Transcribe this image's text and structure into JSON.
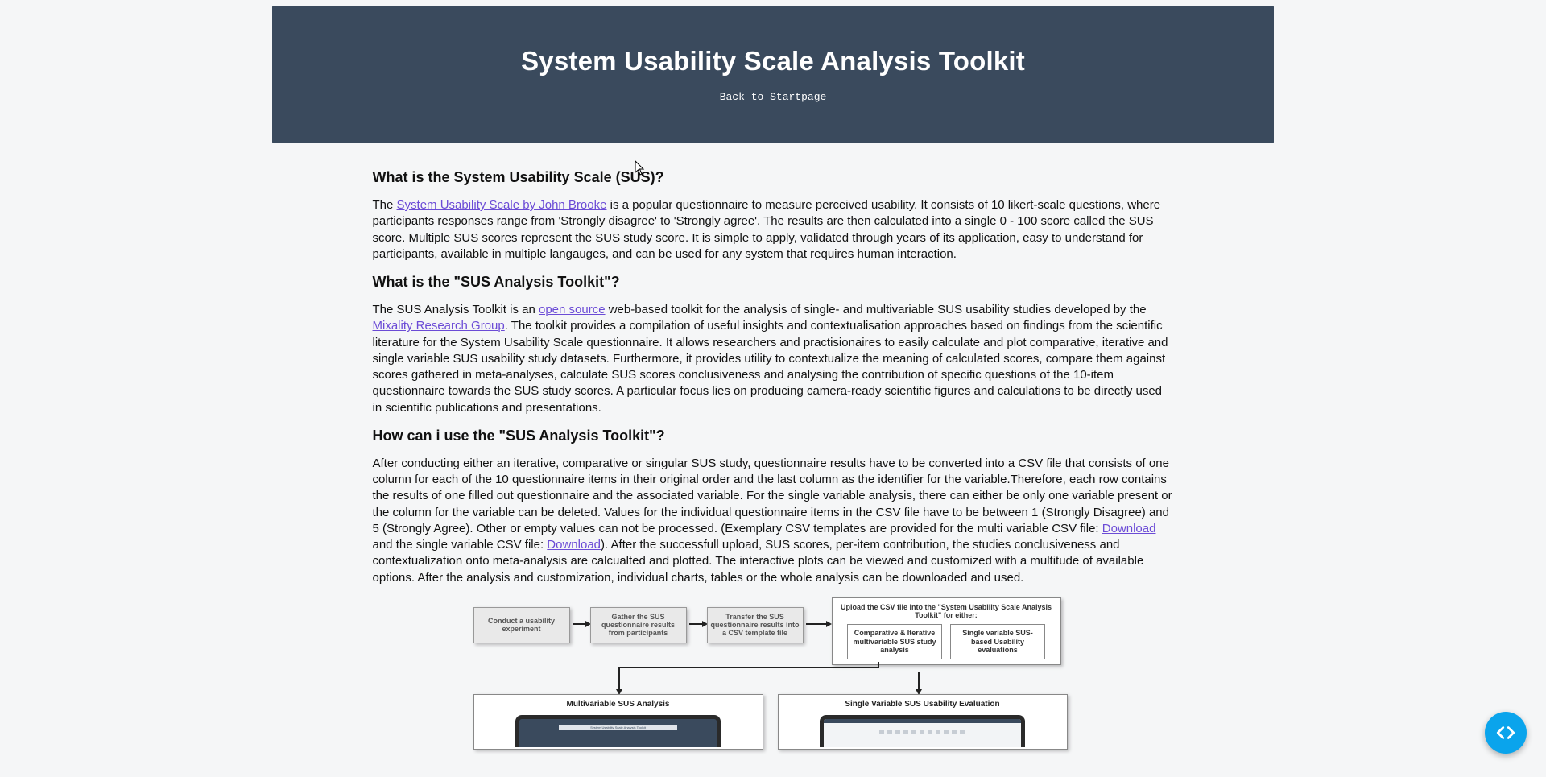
{
  "hero": {
    "title": "System Usability Scale Analysis Toolkit",
    "back_label": "Back to Startpage"
  },
  "sections": {
    "s1_heading": "What is the System Usability Scale (SUS)?",
    "s1_p1_a": "The ",
    "s1_link1": "System Usability Scale by John Brooke",
    "s1_p1_b": " is a popular questionnaire to measure perceived usability. It consists of 10 likert-scale questions, where participants responses range from 'Strongly disagree' to 'Strongly agree'. The results are then calculated into a single 0 - 100 score called the SUS score. Multiple SUS scores represent the SUS study score. It is simple to apply, validated through years of its application, easy to understand for participants, available in multiple langauges, and can be used for any system that requires human interaction.",
    "s2_heading": "What is the \"SUS Analysis Toolkit\"?",
    "s2_p1_a": "The SUS Analysis Toolkit is an ",
    "s2_link1": "open source",
    "s2_p1_b": " web-based toolkit for the analysis of single- and multivariable SUS usability studies developed by the ",
    "s2_link2": "Mixality Research Group",
    "s2_p1_c": ". The toolkit provides a compilation of useful insights and contextualisation approaches based on findings from the scientific literature for the System Usability Scale questionnaire. It allows researchers and practisionaires to easily calculate and plot comparative, iterative and single variable SUS usability study datasets. Furthermore, it provides utility to contextualize the meaning of calculated scores, compare them against scores gathered in meta-analyses, calculate SUS scores conclusiveness and analysing the contribution of specific questions of the 10-item questionnaire towards the SUS study scores. A particular focus lies on producing camera-ready scientific figures and calculations to be directly used in scientific publications and presentations.",
    "s3_heading": "How can i use the \"SUS Analysis Toolkit\"?",
    "s3_p1_a": "After conducting either an iterative, comparative or singular SUS study, questionnaire results have to be converted into a CSV file that consists of one column for each of the 10 questionnaire items in their original order and the last column as the identifier for the variable.Therefore, each row contains the results of one filled out questionnaire and the associated variable. For the single variable analysis, there can either be only one variable present or the column for the variable can be deleted. Values for the individual questionnaire items in the CSV file have to be between 1 (Strongly Disagree) and 5 (Strongly Agree). Other or empty values can not be processed. (Exemplary CSV templates are provided for the multi variable CSV file: ",
    "s3_link1": "Download",
    "s3_p1_b": " and the single variable CSV file: ",
    "s3_link2": "Download",
    "s3_p1_c": "). After the successfull upload, SUS scores, per-item contribution, the studies conclusiveness and contextualization onto meta-analysis are calcualted and plotted. The interactive plots can be viewed and customized with a multitude of available options. After the analysis and customization, individual charts, tables or the whole analysis can be downloaded and used."
  },
  "diagram": {
    "step1": "Conduct a usability experiment",
    "step2": "Gather the SUS questionnaire results from participants",
    "step3": "Transfer the SUS questionnaire results into a CSV template file",
    "upload_title": "Upload the CSV file into the \"System Usability Scale Analysis Toolkit\" for either:",
    "upload_opt1": "Comparative & Iterative multivariable SUS study analysis",
    "upload_opt2": "Single variable SUS-based Usability evaluations",
    "panel_left": "Multivariable SUS Analysis",
    "panel_left_screen_text": "System Usability Scale Analysis Toolkit",
    "panel_right": "Single Variable SUS Usability Evaluation"
  },
  "fab": {
    "name": "code-icon"
  }
}
